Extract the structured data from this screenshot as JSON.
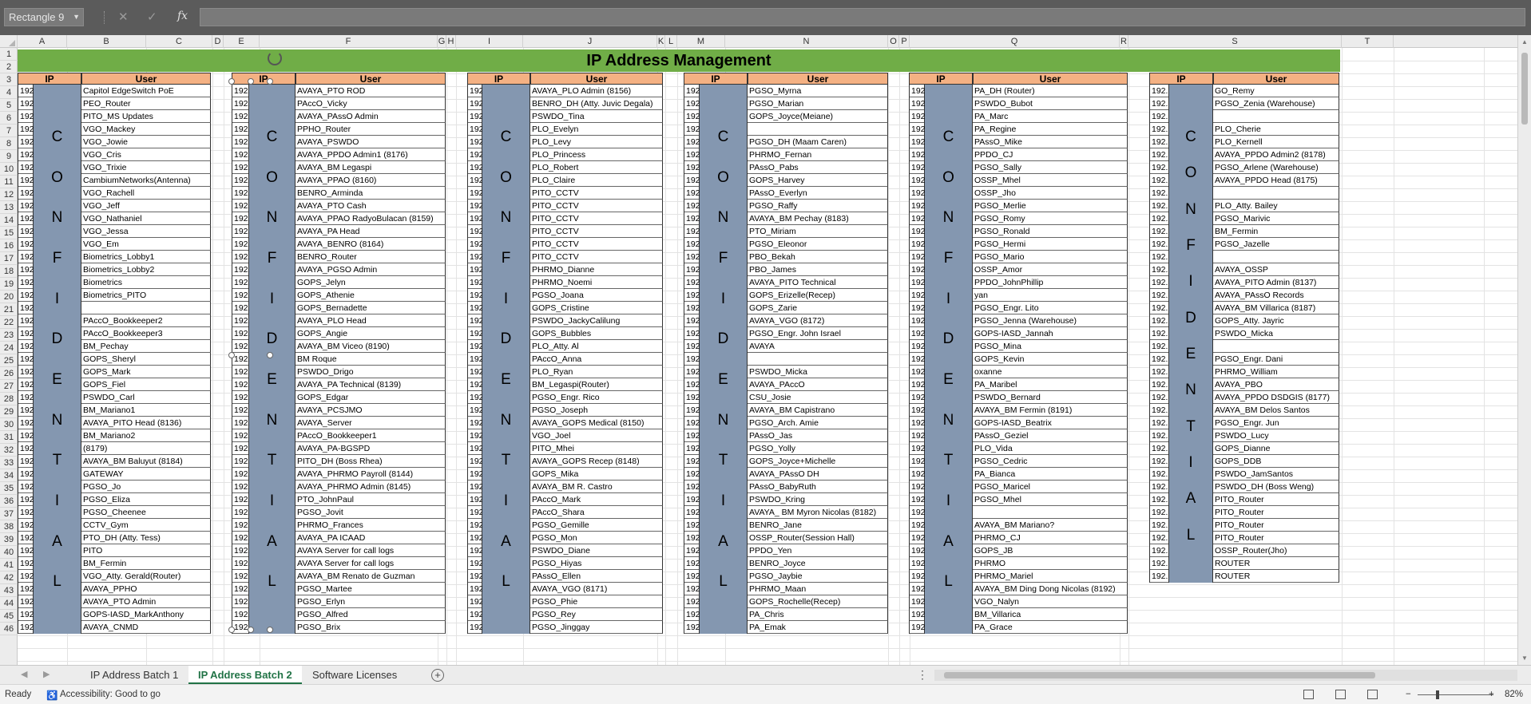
{
  "formula_bar": {
    "name_box": "Rectangle 9",
    "fx_label": "fx",
    "cancel_glyph": "✕",
    "confirm_glyph": "✓",
    "formula": ""
  },
  "columns": [
    "A",
    "B",
    "C",
    "D",
    "E",
    "F",
    "G",
    "H",
    "I",
    "J",
    "K",
    "L",
    "M",
    "N",
    "O",
    "P",
    "Q",
    "R",
    "S",
    "T"
  ],
  "rows": [
    "1",
    "2",
    "3",
    "4",
    "5",
    "6",
    "7",
    "8",
    "9",
    "10",
    "11",
    "12",
    "13",
    "14",
    "15",
    "16",
    "17",
    "18",
    "19",
    "20",
    "21",
    "22",
    "23",
    "24",
    "25",
    "26",
    "27",
    "28",
    "29",
    "30",
    "31",
    "32",
    "33",
    "34",
    "35",
    "36",
    "37",
    "38",
    "39",
    "40",
    "41",
    "42",
    "43",
    "44",
    "45",
    "46"
  ],
  "sheet": {
    "title": "IP Address Management",
    "ip_header": "IP",
    "user_header": "User",
    "ip_prefix": "192.",
    "confidential_letters": [
      "C",
      "O",
      "N",
      "F",
      "I",
      "D",
      "E",
      "N",
      "T",
      "I",
      "A",
      "L"
    ],
    "blocks": [
      {
        "users": [
          "Capitol EdgeSwitch PoE",
          "PEO_Router",
          "PITO_MS Updates",
          "VGO_Mackey",
          "VGO_Jowie",
          "VGO_Cris",
          "VGO_Trixie",
          "CambiumNetworks(Antenna)",
          "VGO_Rachell",
          "VGO_Jeff",
          "VGO_Nathaniel",
          "VGO_Jessa",
          "VGO_Em",
          "Biometrics_Lobby1",
          "Biometrics_Lobby2",
          "Biometrics",
          "Biometrics_PITO",
          "",
          "PAccO_Bookkeeper2",
          "PAccO_Bookkeeper3",
          "BM_Pechay",
          "GOPS_Sheryl",
          "GOPS_Mark",
          "GOPS_Fiel",
          "PSWDO_Carl",
          "BM_Mariano1",
          "AVAYA_PITO Head (8136)",
          "BM_Mariano2",
          "(8179)",
          "AVAYA_BM Baluyut (8184)",
          "GATEWAY",
          "PGSO_Jo",
          "PGSO_Eliza",
          "PGSO_Cheenee",
          "CCTV_Gym",
          "PTO_DH (Atty. Tess)",
          "PITO",
          "BM_Fermin",
          "VGO_Atty. Gerald(Router)",
          "AVAYA_PPHO",
          "AVAYA_PTO Admin",
          "GOPS-IASD_MarkAnthony",
          "AVAYA_CNMD"
        ]
      },
      {
        "users": [
          "AVAYA_PTO ROD",
          "PAccO_Vicky",
          "AVAYA_PAssO Admin",
          "PPHO_Router",
          "AVAYA_PSWDO",
          "AVAYA_PPDO Admin1 (8176)",
          "AVAYA_BM Legaspi",
          "AVAYA_PPAO (8160)",
          "BENRO_Arminda",
          "AVAYA_PTO Cash",
          "AVAYA_PPAO RadyoBulacan (8159)",
          "AVAYA_PA Head",
          "AVAYA_BENRO (8164)",
          "BENRO_Router",
          "AVAYA_PGSO Admin",
          "GOPS_Jelyn",
          "GOPS_Athenie",
          "GOPS_Bernadette",
          "AVAYA_PLO Head",
          "GOPS_Angie",
          "AVAYA_BM Viceo (8190)",
          "BM Roque",
          "PSWDO_Drigo",
          "AVAYA_PA Technical (8139)",
          "GOPS_Edgar",
          "AVAYA_PCSJMO",
          "AVAYA_Server",
          "PAccO_Bookkeeper1",
          "AVAYA_PA-BGSPD",
          "PITO_DH (Boss Rhea)",
          "AVAYA_PHRMO Payroll (8144)",
          "AVAYA_PHRMO Admin (8145)",
          "PTO_JohnPaul",
          "PGSO_Jovit",
          "PHRMO_Frances",
          "AVAYA_PA ICAAD",
          "AVAYA Server for call logs",
          "AVAYA Server for call logs",
          "AVAYA_BM Renato de Guzman",
          "PGSO_Martee",
          "PGSO_Erlyn",
          "PGSO_Alfred",
          "PGSO_Brix"
        ]
      },
      {
        "users": [
          "AVAYA_PLO Admin (8156)",
          "BENRO_DH (Atty. Juvic Degala)",
          "PSWDO_Tina",
          "PLO_Evelyn",
          "PLO_Levy",
          "PLO_Princess",
          "PLO_Robert",
          "PLO_Claire",
          "PITO_CCTV",
          "PITO_CCTV",
          "PITO_CCTV",
          "PITO_CCTV",
          "PITO_CCTV",
          "PITO_CCTV",
          "PHRMO_Dianne",
          "PHRMO_Noemi",
          "PGSO_Joana",
          "GOPS_Cristine",
          "PSWDO_JackyCalilung",
          "GOPS_Bubbles",
          "PLO_Atty. Al",
          "PAccO_Anna",
          "PLO_Ryan",
          "BM_Legaspi(Router)",
          "PGSO_Engr. Rico",
          "PGSO_Joseph",
          "AVAYA_GOPS Medical (8150)",
          "VGO_Joel",
          "PITO_Mhei",
          "AVAYA_GOPS Recep (8148)",
          "GOPS_Mika",
          "AVAYA_BM R. Castro",
          "PAccO_Mark",
          "PAccO_Shara",
          "PGSO_Gemille",
          "PGSO_Mon",
          "PSWDO_Diane",
          "PGSO_Hiyas",
          "PAssO_Ellen",
          "AVAYA_VGO (8171)",
          "PGSO_Phie",
          "PGSO_Rey",
          "PGSO_Jinggay"
        ]
      },
      {
        "users": [
          "PGSO_Myrna",
          "PGSO_Marian",
          "GOPS_Joyce(Meiane)",
          "",
          "PGSO_DH (Maam Caren)",
          "PHRMO_Fernan",
          "PAssO_Pabs",
          "GOPS_Harvey",
          "PAssO_Everlyn",
          "PGSO_Raffy",
          "AVAYA_BM Pechay (8183)",
          "PTO_Miriam",
          "PGSO_Eleonor",
          "PBO_Bekah",
          "PBO_James",
          "AVAYA_PITO Technical",
          "GOPS_Erizelle(Recep)",
          "GOPS_Zarie",
          "AVAYA_VGO (8172)",
          "PGSO_Engr. John Israel",
          "AVAYA",
          "",
          "PSWDO_Micka",
          "AVAYA_PAccO",
          "CSU_Josie",
          "AVAYA_BM Capistrano",
          "PGSO_Arch. Amie",
          "PAssO_Jas",
          "PGSO_Yolly",
          "GOPS_Joyce+Michelle",
          "AVAYA_PAssO DH",
          "PAssO_BabyRuth",
          "PSWDO_Kring",
          "AVAYA_ BM Myron Nicolas (8182)",
          "BENRO_Jane",
          "OSSP_Router(Session Hall)",
          "PPDO_Yen",
          "BENRO_Joyce",
          "PGSO_Jaybie",
          "PHRMO_Maan",
          "GOPS_Rochelle(Recep)",
          "PA_Chris",
          "PA_Emak"
        ]
      },
      {
        "users": [
          "PA_DH (Router)",
          "PSWDO_Bubot",
          "PA_Marc",
          "PA_Regine",
          "PAssO_Mike",
          "PPDO_CJ",
          "PGSO_Sally",
          "OSSP_Mhel",
          "OSSP_Jho",
          "PGSO_Merlie",
          "PGSO_Romy",
          "PGSO_Ronald",
          "PGSO_Hermi",
          "PGSO_Mario",
          "OSSP_Amor",
          "PPDO_JohnPhillip",
          "yan",
          "PGSO_Engr. Lito",
          "PGSO_Jenna (Warehouse)",
          "GOPS-IASD_Jannah",
          "PGSO_Mina",
          "GOPS_Kevin",
          "oxanne",
          "PA_Maribel",
          "PSWDO_Bernard",
          "AVAYA_BM Fermin (8191)",
          "GOPS-IASD_Beatrix",
          "PAssO_Geziel",
          "PLO_Vida",
          "PGSO_Cedric",
          "PA_Bianca",
          "PGSO_Maricel",
          "PGSO_Mhel",
          "",
          "AVAYA_BM Mariano?",
          "PHRMO_CJ",
          "GOPS_JB",
          "PHRMO",
          "PHRMO_Mariel",
          "AVAYA_BM Ding Dong Nicolas (8192)",
          "VGO_Nalyn",
          "BM_Villarica",
          "PA_Grace"
        ]
      },
      {
        "users": [
          "GO_Remy",
          "PGSO_Zenia (Warehouse)",
          "",
          "PLO_Cherie",
          "PLO_Kernell",
          "AVAYA_PPDO Admin2 (8178)",
          "PGSO_Arlene (Warehouse)",
          "AVAYA_PPDO Head (8175)",
          "",
          "PLO_Atty. Bailey",
          "PGSO_Marivic",
          "BM_Fermin",
          "PGSO_Jazelle",
          "",
          "AVAYA_OSSP",
          "AVAYA_PITO Admin (8137)",
          "AVAYA_PAssO Records",
          "AVAYA_BM Villarica (8187)",
          "GOPS_Atty. Jayric",
          "PSWDO_Micka",
          "",
          "PGSO_Engr. Dani",
          "PHRMO_William",
          "AVAYA_PBO",
          "AVAYA_PPDO DSDGIS (8177)",
          "AVAYA_BM Delos Santos",
          "PGSO_Engr. Jun",
          "PSWDO_Lucy",
          "GOPS_Dianne",
          "GOPS_DDB",
          "PSWDO_JamSantos",
          "PSWDO_DH (Boss Weng)",
          "PITO_Router",
          "PITO_Router",
          "PITO_Router",
          "PITO_Router",
          "OSSP_Router(Jho)",
          "ROUTER",
          "ROUTER"
        ]
      }
    ]
  },
  "tabs": {
    "items": [
      "IP Address Batch 1",
      "IP Address Batch 2",
      "Software Licenses"
    ],
    "active": "IP Address Batch 2",
    "add_glyph": "+",
    "more_glyph": "⋮"
  },
  "status": {
    "mode": "Ready",
    "accessibility": "Accessibility: Good to go",
    "zoom": "82%",
    "zoom_minus": "−",
    "zoom_plus": "+"
  },
  "colors": {
    "title_bg": "#70ad47",
    "header_bg": "#f4b183",
    "confidential_bg": "#8497b0",
    "active_tab": "#217346"
  },
  "icons": [
    "dropdown-icon",
    "cancel-icon",
    "confirm-icon",
    "fx-icon",
    "rotate-handle-icon",
    "add-sheet-icon",
    "accessibility-icon",
    "normal-view-icon",
    "page-layout-icon",
    "page-break-icon"
  ]
}
